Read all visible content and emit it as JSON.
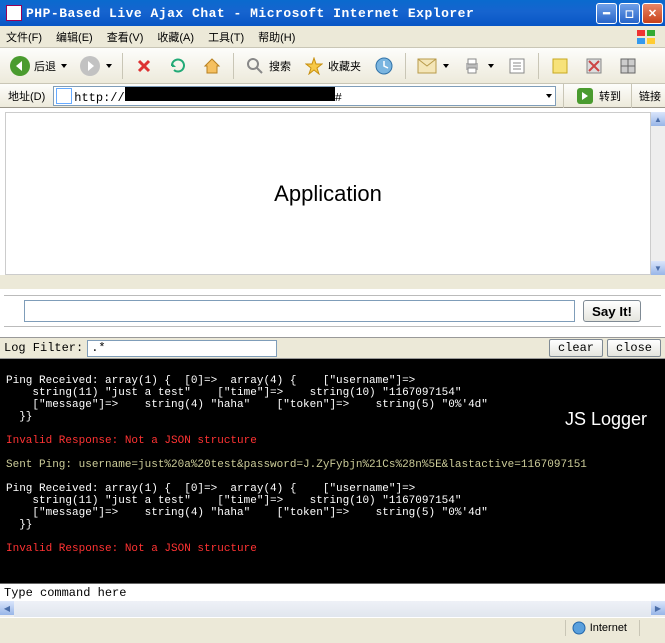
{
  "window": {
    "title": "PHP-Based Live Ajax Chat - Microsoft Internet Explorer"
  },
  "menu": {
    "file": "文件(F)",
    "edit": "编辑(E)",
    "view": "查看(V)",
    "fav": "收藏(A)",
    "tools": "工具(T)",
    "help": "帮助(H)"
  },
  "toolbar": {
    "back": "后退",
    "search": "搜索",
    "favorites": "收藏夹"
  },
  "address": {
    "label": "地址(D)",
    "protocol": "http://",
    "hash": "#",
    "go": "转到",
    "links": "链接"
  },
  "app": {
    "heading": "Application",
    "sayit": "Say It!"
  },
  "logger": {
    "filter_label": "Log Filter:",
    "filter_value": ".*",
    "clear": "clear",
    "close": "close",
    "brand": "JS Logger",
    "cmd_placeholder": "Type command here",
    "lines": {
      "ping1": "Ping Received: array(1) {  [0]=>  array(4) {    [\"username\"]=>",
      "ping1b": "    string(11) \"just a test\"    [\"time\"]=>    string(10) \"1167097154\"",
      "ping1c": "    [\"message\"]=>    string(4) \"haha\"    [\"token\"]=>    string(5) \"0%'4d\"",
      "ping1d": "  }}",
      "err1": "Invalid Response: Not a JSON structure",
      "sent": "Sent Ping: username=just%20a%20test&password=J.ZyFybjn%21Cs%28n%5E&lastactive=1167097151",
      "ping2": "Ping Received: array(1) {  [0]=>  array(4) {    [\"username\"]=>",
      "ping2b": "    string(11) \"just a test\"    [\"time\"]=>    string(10) \"1167097154\"",
      "ping2c": "    [\"message\"]=>    string(4) \"haha\"    [\"token\"]=>    string(5) \"0%'4d\"",
      "ping2d": "  }}",
      "err2": "Invalid Response: Not a JSON structure"
    }
  },
  "status": {
    "zone": "Internet"
  }
}
